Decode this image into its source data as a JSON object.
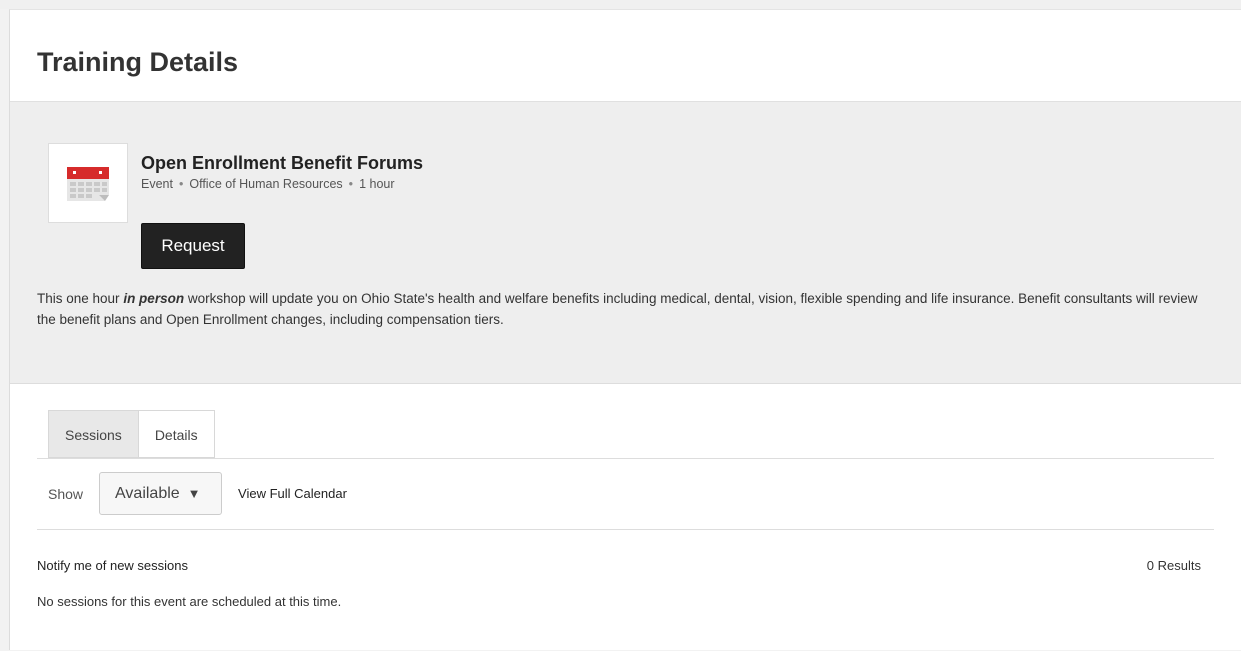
{
  "page": {
    "title": "Training Details"
  },
  "event": {
    "title": "Open Enrollment Benefit Forums",
    "type": "Event",
    "provider": "Office of Human Resources",
    "duration": "1 hour",
    "icon": "calendar-icon",
    "request_label": "Request",
    "description": {
      "before": "This one hour ",
      "emphasis": "in person",
      "after": " workshop will update you on Ohio State's health and welfare benefits including medical, dental, vision, flexible spending and life insurance. Benefit consultants will review the benefit plans and Open Enrollment changes, including compensation tiers."
    }
  },
  "tabs": [
    {
      "label": "Sessions",
      "active": true
    },
    {
      "label": "Details",
      "active": false
    }
  ],
  "filters": {
    "show_label": "Show",
    "selected": "Available",
    "view_calendar_label": "View Full Calendar"
  },
  "sessions": {
    "notify_label": "Notify me of new sessions",
    "results": "0 Results",
    "empty_message": "No sessions for this event are scheduled at this time."
  },
  "colors": {
    "calendar_red": "#d62b2b",
    "button_bg": "#222222",
    "summary_bg": "#eeeeee"
  }
}
